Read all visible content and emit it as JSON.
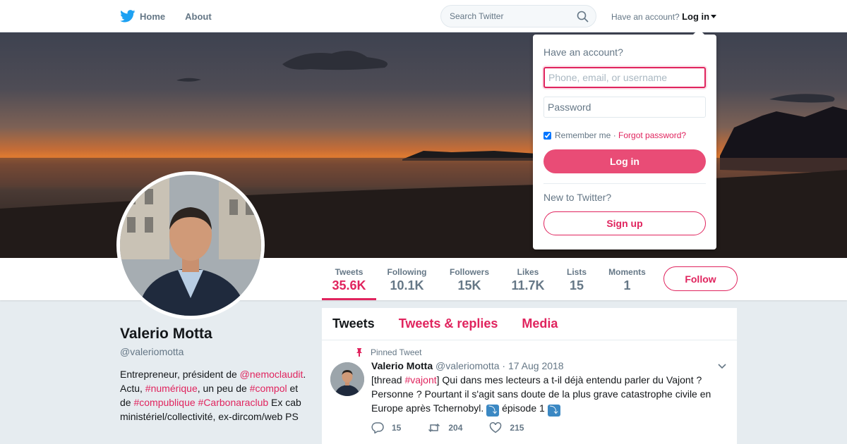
{
  "nav": {
    "home_label": "Home",
    "about_label": "About",
    "search_placeholder": "Search Twitter",
    "account_prompt": "Have an account?",
    "login_label": "Log in"
  },
  "profile": {
    "name": "Valerio Motta",
    "handle": "@valeriomotta",
    "bio": {
      "p1": "Entrepreneur, président de ",
      "link1": "@nemoclaudit",
      "p2": ". Actu, ",
      "link2": "#numérique",
      "p3": ", un peu de ",
      "link3": "#compol",
      "p4": " et de ",
      "link4": "#compublique",
      "p5": " ",
      "link5": "#Carbonaraclub",
      "p6": " Ex cab ministériel/collectivité, ex-dircom/web PS"
    }
  },
  "stats": [
    {
      "label": "Tweets",
      "value": "35.6K"
    },
    {
      "label": "Following",
      "value": "10.1K"
    },
    {
      "label": "Followers",
      "value": "15K"
    },
    {
      "label": "Likes",
      "value": "11.7K"
    },
    {
      "label": "Lists",
      "value": "15"
    },
    {
      "label": "Moments",
      "value": "1"
    }
  ],
  "follow_label": "Follow",
  "timeline": {
    "tabs": [
      "Tweets",
      "Tweets & replies",
      "Media"
    ],
    "pinned_label": "Pinned Tweet",
    "tweet": {
      "name": "Valerio Motta",
      "handle": "@valeriomotta",
      "separator": "·",
      "date": "17 Aug 2018",
      "t1": "[thread ",
      "hashtag": "#vajont",
      "t2": "] Qui dans mes lecteurs a t-il déjà entendu parler du Vajont ? Personne ? Pourtant il s'agit sans doute de la plus grave catastrophe civile en Europe après Tchernobyl. ",
      "emoji1": "⤵",
      "t3": " épisode 1 ",
      "emoji2": "⤵",
      "replies": "15",
      "retweets": "204",
      "likes": "215"
    }
  },
  "login_dropdown": {
    "title": "Have an account?",
    "username_placeholder": "Phone, email, or username",
    "password_placeholder": "Password",
    "remember_label": "Remember me",
    "separator": " · ",
    "forgot_label": "Forgot password?",
    "login_button": "Log in",
    "new_prompt": "New to Twitter?",
    "signup_button": "Sign up"
  },
  "colors": {
    "accent": "#e0245e",
    "twitter_blue": "#1da1f2",
    "muted": "#657786"
  }
}
